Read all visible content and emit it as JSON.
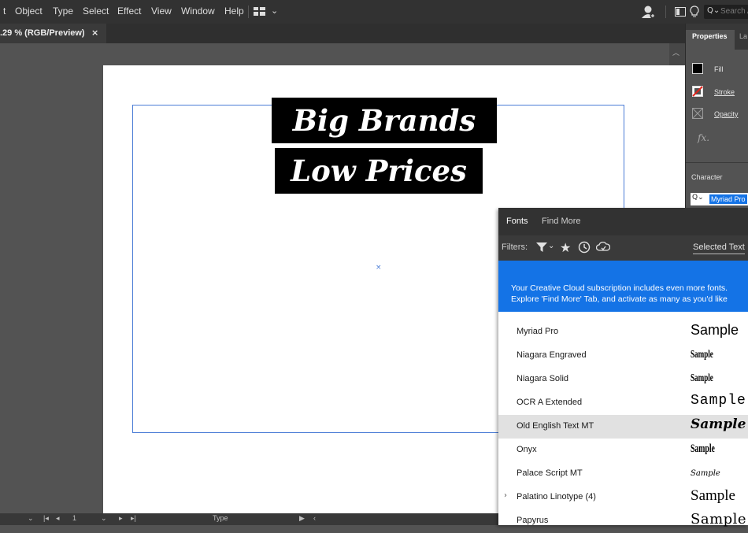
{
  "menubar": {
    "items": [
      "t",
      "Object",
      "Type",
      "Select",
      "Effect",
      "View",
      "Window",
      "Help"
    ],
    "search_placeholder": "Search A"
  },
  "document": {
    "tab_label": ".29 % (RGB/Preview)",
    "close_label": "×"
  },
  "artwork": {
    "line1": "Big Brands",
    "line2": "Low Prices"
  },
  "statusbar": {
    "page": "1",
    "tool": "Type"
  },
  "properties_panel": {
    "tabs": [
      "Properties",
      "La"
    ],
    "fill_label": "Fill",
    "stroke_label": "Stroke",
    "opacity_label": "Opacity",
    "fx_label": "fx.",
    "character_label": "Character",
    "font_field_value": "Myriad Pro"
  },
  "font_panel": {
    "tabs": [
      "Fonts",
      "Find More"
    ],
    "filters_label": "Filters:",
    "selected_text_label": "Selected Text",
    "banner_line1": "Your Creative Cloud subscription includes even more fonts.",
    "banner_line2": "Explore 'Find More' Tab, and activate as many as you'd like",
    "highlight_color": "#e1e1e1",
    "banner_color": "#1473e6",
    "fonts": [
      {
        "name": "Myriad Pro",
        "sample": "Sample",
        "expandable": false,
        "highlighted": false
      },
      {
        "name": "Niagara Engraved",
        "sample": "Sample",
        "expandable": false,
        "highlighted": false
      },
      {
        "name": "Niagara Solid",
        "sample": "Sample",
        "expandable": false,
        "highlighted": false
      },
      {
        "name": "OCR A Extended",
        "sample": "Sample",
        "expandable": false,
        "highlighted": false
      },
      {
        "name": "Old English Text MT",
        "sample": "Sample",
        "expandable": false,
        "highlighted": true
      },
      {
        "name": "Onyx",
        "sample": "Sample",
        "expandable": false,
        "highlighted": false
      },
      {
        "name": "Palace Script MT",
        "sample": "Sample",
        "expandable": false,
        "highlighted": false
      },
      {
        "name": "Palatino Linotype (4)",
        "sample": "Sample",
        "expandable": true,
        "highlighted": false
      },
      {
        "name": "Papyrus",
        "sample": "Sample",
        "expandable": false,
        "highlighted": false
      }
    ]
  }
}
